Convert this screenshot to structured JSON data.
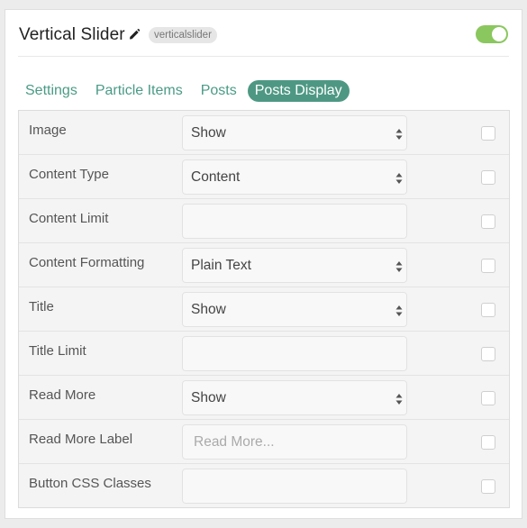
{
  "header": {
    "title": "Vertical Slider",
    "badge": "verticalslider",
    "toggle_on": true
  },
  "tabs": [
    {
      "label": "Settings",
      "active": false
    },
    {
      "label": "Particle Items",
      "active": false
    },
    {
      "label": "Posts",
      "active": false
    },
    {
      "label": "Posts Display",
      "active": true
    }
  ],
  "rows": [
    {
      "label": "Image",
      "type": "select",
      "value": "Show"
    },
    {
      "label": "Content Type",
      "type": "select",
      "value": "Content"
    },
    {
      "label": "Content Limit",
      "type": "input",
      "value": "",
      "placeholder": ""
    },
    {
      "label": "Content Formatting",
      "type": "select",
      "value": "Plain Text"
    },
    {
      "label": "Title",
      "type": "select",
      "value": "Show"
    },
    {
      "label": "Title Limit",
      "type": "input",
      "value": "",
      "placeholder": ""
    },
    {
      "label": "Read More",
      "type": "select",
      "value": "Show"
    },
    {
      "label": "Read More Label",
      "type": "input",
      "value": "",
      "placeholder": "Read More..."
    },
    {
      "label": "Button CSS Classes",
      "type": "input",
      "value": "",
      "placeholder": ""
    }
  ],
  "colors": {
    "accent": "#4e9883",
    "tab_text": "#4a9b85",
    "toggle": "#8bc75f"
  },
  "icons": {
    "edit": "pencil-icon",
    "select": "select-arrows-icon"
  }
}
